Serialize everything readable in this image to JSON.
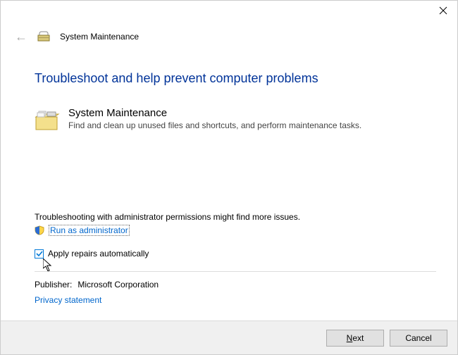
{
  "titlebar": {
    "close_aria": "Close"
  },
  "header": {
    "title": "System Maintenance"
  },
  "main": {
    "heading": "Troubleshoot and help prevent computer problems",
    "troubleshooter_title": "System Maintenance",
    "troubleshooter_desc": "Find and clean up unused files and shortcuts, and perform maintenance tasks."
  },
  "admin": {
    "note": "Troubleshooting with administrator permissions might find more issues.",
    "link": "Run as administrator"
  },
  "options": {
    "apply_repairs_label": "Apply repairs automatically",
    "apply_repairs_checked": true
  },
  "publisher": {
    "label": "Publisher:",
    "value": "Microsoft Corporation"
  },
  "privacy": {
    "link": "Privacy statement"
  },
  "footer": {
    "next_label": "Next",
    "cancel_label": "Cancel"
  }
}
